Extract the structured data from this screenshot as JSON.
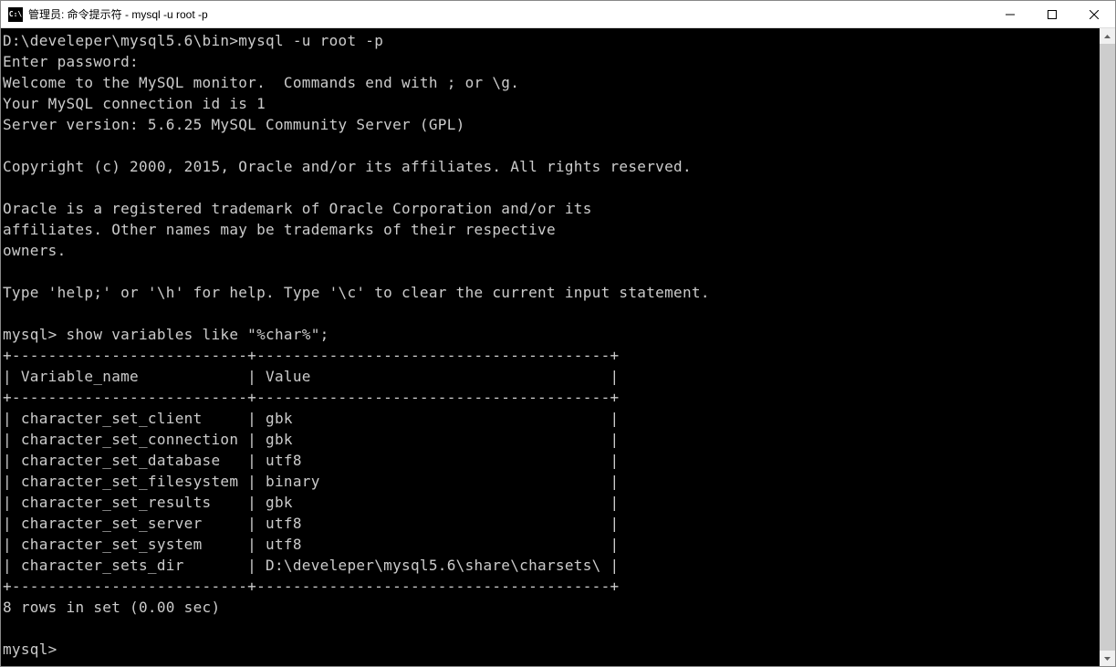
{
  "window": {
    "title": "管理员: 命令提示符 - mysql  -u root -p"
  },
  "terminal": {
    "prompt_path": "D:\\develeper\\mysql5.6\\bin>",
    "command1": "mysql -u root -p",
    "line_password": "Enter password:",
    "line_welcome": "Welcome to the MySQL monitor.  Commands end with ; or \\g.",
    "line_connid": "Your MySQL connection id is 1",
    "line_version": "Server version: 5.6.25 MySQL Community Server (GPL)",
    "line_copyright": "Copyright (c) 2000, 2015, Oracle and/or its affiliates. All rights reserved.",
    "line_trademark1": "Oracle is a registered trademark of Oracle Corporation and/or its",
    "line_trademark2": "affiliates. Other names may be trademarks of their respective",
    "line_trademark3": "owners.",
    "line_help": "Type 'help;' or '\\h' for help. Type '\\c' to clear the current input statement.",
    "mysql_prompt": "mysql>",
    "command2": " show variables like \"%char%\";",
    "table_border_top": "+--------------------------+---------------------------------------+",
    "table_header": "| Variable_name            | Value                                 |",
    "table_border_mid": "+--------------------------+---------------------------------------+",
    "table_rows": [
      "| character_set_client     | gbk                                   |",
      "| character_set_connection | gbk                                   |",
      "| character_set_database   | utf8                                  |",
      "| character_set_filesystem | binary                                |",
      "| character_set_results    | gbk                                   |",
      "| character_set_server     | utf8                                  |",
      "| character_set_system     | utf8                                  |",
      "| character_sets_dir       | D:\\develeper\\mysql5.6\\share\\charsets\\ |"
    ],
    "table_border_bot": "+--------------------------+---------------------------------------+",
    "rows_summary": "8 rows in set (0.00 sec)",
    "final_prompt": "mysql>"
  }
}
